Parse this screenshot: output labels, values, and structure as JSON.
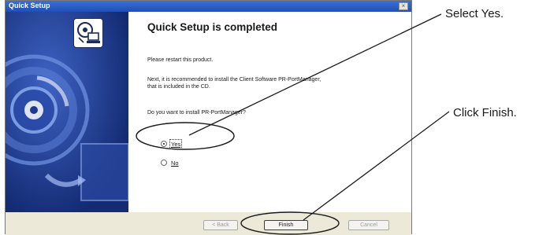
{
  "window": {
    "title": "Quick Setup",
    "close_glyph": "×"
  },
  "content": {
    "headline": "Quick Setup is completed",
    "line1": "Please restart this product.",
    "line2a": "Next, it is recommended to install the Client Software PR-PortManager,",
    "line2b": "that is included in the CD.",
    "question": "Do you want to install PR-PortManager?",
    "options": [
      {
        "label": "Yes",
        "selected": true
      },
      {
        "label": "No",
        "selected": false
      }
    ]
  },
  "footer": {
    "back_label": "< Back",
    "finish_label": "Finish",
    "cancel_label": "Cancel"
  },
  "annotations": {
    "select_yes": "Select Yes.",
    "click_finish": "Click Finish."
  },
  "icons": [
    "close-icon",
    "network-computer-icon",
    "cd-disc-graphic",
    "radio-icon"
  ],
  "colors": {
    "titlebar": "#1f4fb6",
    "sidebar": "#1f3f96",
    "dialog_bg": "#ece9d8"
  }
}
